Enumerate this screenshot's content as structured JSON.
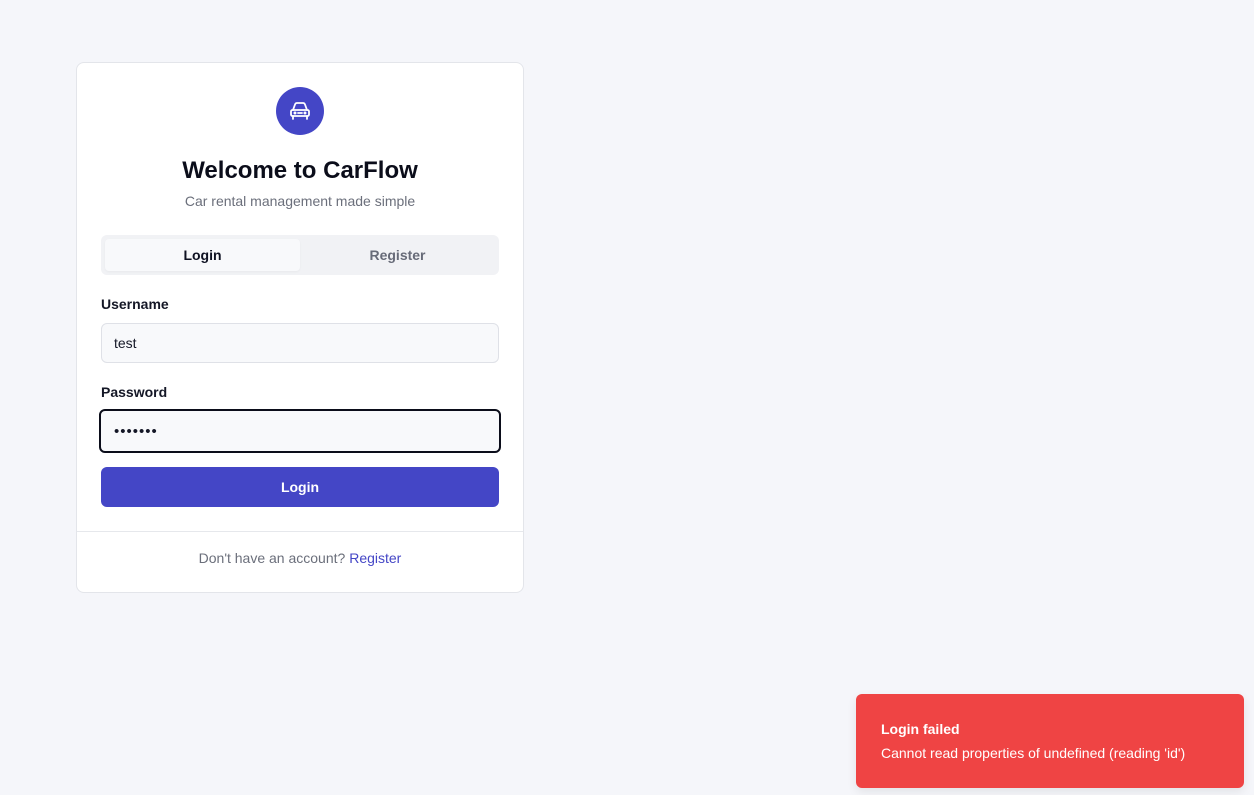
{
  "brand": {
    "title": "Welcome to CarFlow",
    "subtitle": "Car rental management made simple",
    "logo_icon": "car-icon",
    "accent_color": "#4446c6"
  },
  "tabs": [
    {
      "label": "Login",
      "active": true
    },
    {
      "label": "Register",
      "active": false
    }
  ],
  "form": {
    "username_label": "Username",
    "username_value": "test",
    "password_label": "Password",
    "password_value": "•••••••",
    "submit_label": "Login"
  },
  "footer": {
    "prompt": "Don't have an account?",
    "link_label": "Register"
  },
  "toast": {
    "title": "Login failed",
    "message": "Cannot read properties of undefined (reading 'id')",
    "color": "#ef4444"
  }
}
